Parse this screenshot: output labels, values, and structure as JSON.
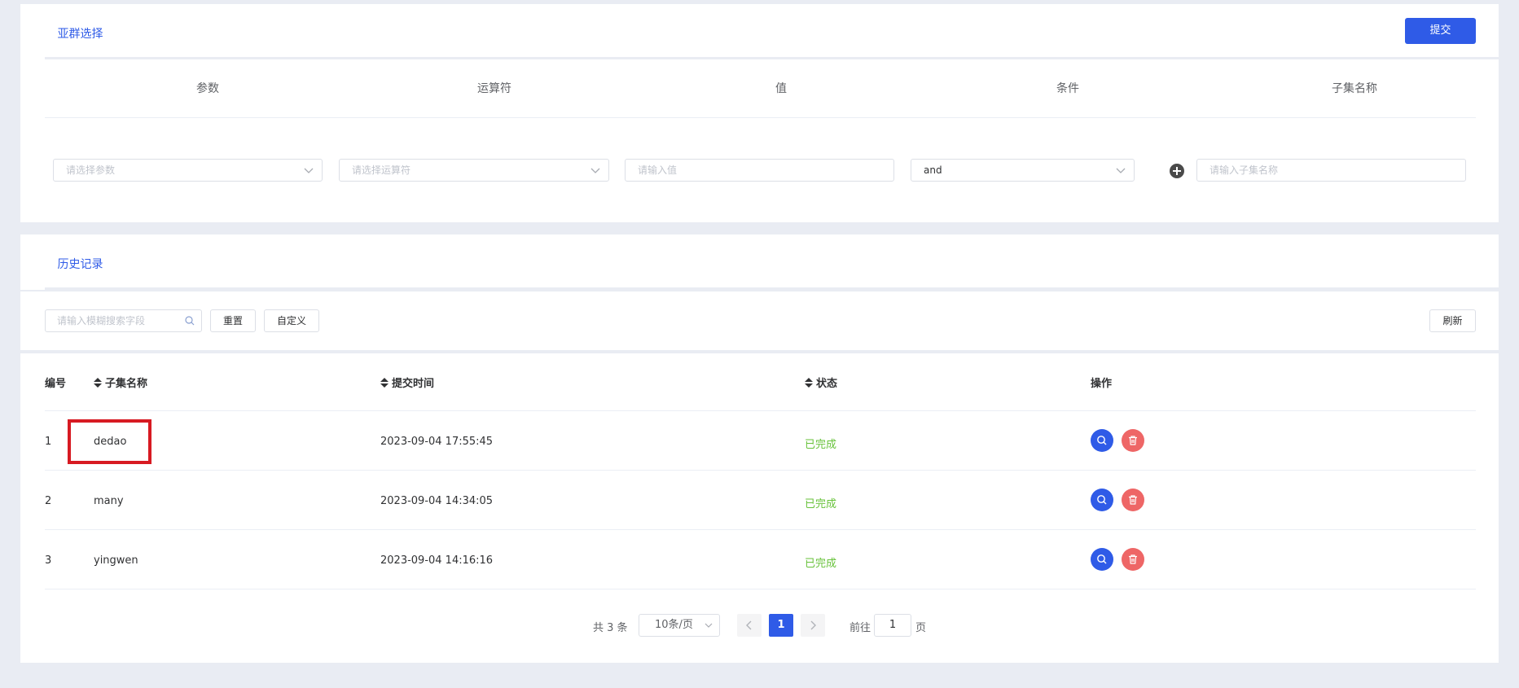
{
  "subgroup": {
    "tab_label": "亚群选择",
    "submit_label": "提交",
    "columns": [
      "参数",
      "运算符",
      "值",
      "条件",
      "子集名称"
    ],
    "param_placeholder": "请选择参数",
    "operator_placeholder": "请选择运算符",
    "value_placeholder": "请输入值",
    "condition_value": "and",
    "subset_placeholder": "请输入子集名称",
    "add_icon": "plus-circle-icon"
  },
  "history": {
    "tab_label": "历史记录",
    "search_placeholder": "请输入模糊搜索字段",
    "reset_label": "重置",
    "custom_label": "自定义",
    "refresh_label": "刷新"
  },
  "table": {
    "headers": {
      "id": "编号",
      "name": "子集名称",
      "time": "提交时间",
      "status": "状态",
      "actions": "操作"
    },
    "rows": [
      {
        "id": "1",
        "name": "dedao",
        "time": "2023-09-04 17:55:45",
        "status": "已完成"
      },
      {
        "id": "2",
        "name": "many",
        "time": "2023-09-04 14:34:05",
        "status": "已完成"
      },
      {
        "id": "3",
        "name": "yingwen",
        "time": "2023-09-04 14:16:16",
        "status": "已完成"
      }
    ]
  },
  "pagination": {
    "total_text": "共 3 条",
    "page_size": "10条/页",
    "current_page": "1",
    "goto_prefix": "前往",
    "goto_value": "1",
    "goto_suffix": "页"
  },
  "colors": {
    "primary": "#2f5be7",
    "success": "#67c23a",
    "danger": "#ee6666",
    "highlight": "#d71a22"
  }
}
